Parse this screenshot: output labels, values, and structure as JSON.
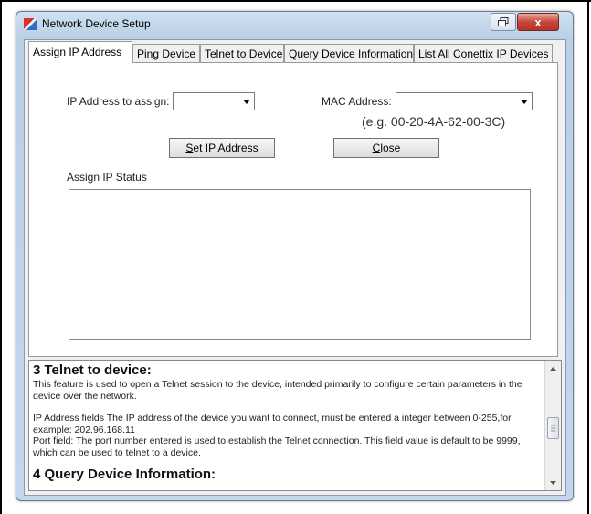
{
  "window": {
    "title": "Network Device Setup",
    "close_glyph": "x"
  },
  "tabs": [
    {
      "label": "Assign IP Address",
      "active": true
    },
    {
      "label": "Ping Device",
      "active": false
    },
    {
      "label": "Telnet to Device",
      "active": false
    },
    {
      "label": "Query Device Information",
      "active": false
    },
    {
      "label": "List All Conettix IP Devices",
      "active": false
    }
  ],
  "assign": {
    "ip_label": "IP Address to assign:",
    "ip_value": "",
    "mac_label": "MAC Address:",
    "mac_value": "",
    "mac_example": "(e.g. 00-20-4A-62-00-3C)",
    "set_button_mnemonic": "S",
    "set_button_rest": "et IP Address",
    "close_button_mnemonic": "C",
    "close_button_rest": "lose",
    "status_label": "Assign IP Status",
    "status_text": ""
  },
  "help": {
    "section3_title": "3 Telnet to device:",
    "section3_p1": "This feature is used to open a Telnet session to the device, intended primarily to configure certain parameters in the device over the network.",
    "section3_p2": "IP Address fields The IP address of the device you want to connect, must be entered a integer between 0-255,for example: 202.96.168.11",
    "section3_p3": "Port field: The port number entered is used to establish the Telnet connection. This field value is default to be 9999, which can be used to telnet to a device.",
    "section4_title": "4 Query Device Information:"
  },
  "icons": {
    "app": "network-setup-icon",
    "restore": "restore-icon",
    "close": "close-icon",
    "dropdown": "chevron-down-icon"
  }
}
